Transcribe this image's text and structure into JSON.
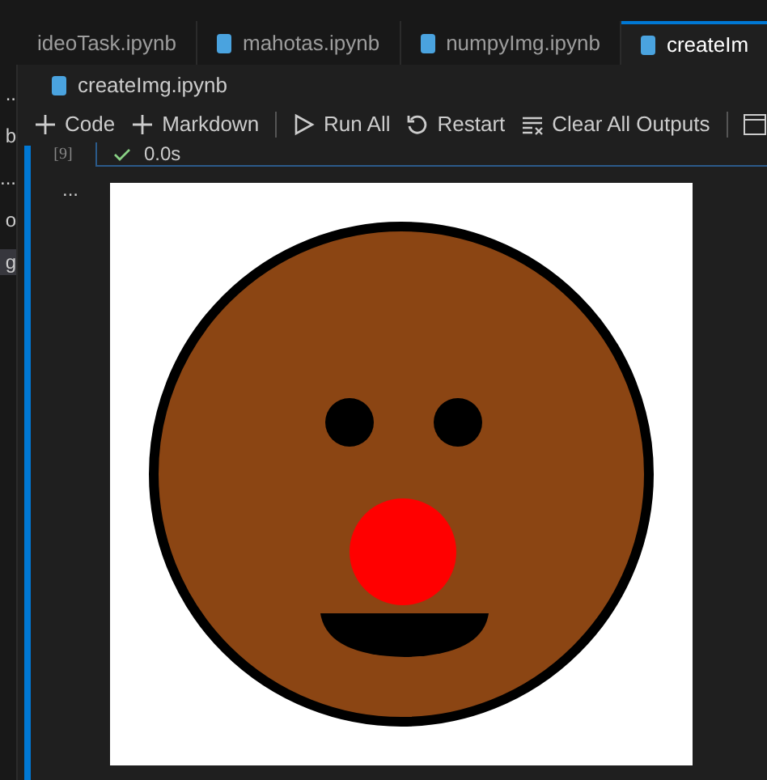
{
  "tabs": [
    {
      "label": "ideoTask.ipynb",
      "selected": false,
      "icon": false
    },
    {
      "label": "mahotas.ipynb",
      "selected": false,
      "icon": true
    },
    {
      "label": "numpyImg.ipynb",
      "selected": false,
      "icon": true
    },
    {
      "label": "createIm",
      "selected": true,
      "icon": true
    }
  ],
  "breadcrumb": "createImg.ipynb",
  "toolbar": [
    {
      "label": "Code",
      "kind": "plus"
    },
    {
      "label": "Markdown",
      "kind": "plus"
    },
    {
      "label": "Run All",
      "kind": "run"
    },
    {
      "label": "Restart",
      "kind": "restart"
    },
    {
      "label": "Clear All Outputs",
      "kind": "clear"
    }
  ],
  "sidebar": {
    "items": [
      {
        "label": "..",
        "selected": false
      },
      {
        "label": "b",
        "selected": false
      },
      {
        "label": "...",
        "selected": false
      },
      {
        "label": "o",
        "selected": false
      },
      {
        "label": "g",
        "selected": true
      }
    ]
  },
  "cell": {
    "count": "[9]",
    "time": "0.0s",
    "succeeded": true,
    "more": "..."
  }
}
